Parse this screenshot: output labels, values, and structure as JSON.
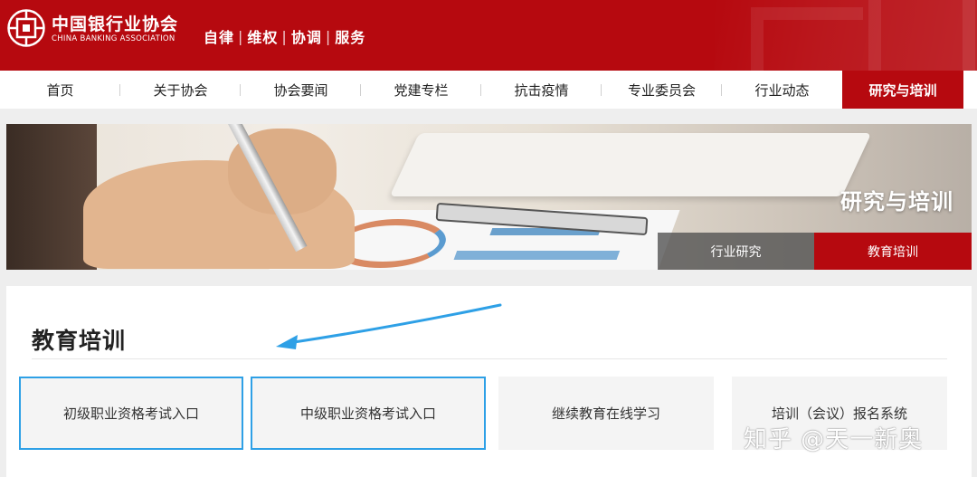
{
  "header": {
    "logo_cn": "中国银行业协会",
    "logo_en": "CHINA BANKING ASSOCIATION",
    "slogan": [
      "自律",
      "维权",
      "协调",
      "服务"
    ],
    "brand_color": "#b6090f"
  },
  "nav": {
    "items": [
      {
        "label": "首页"
      },
      {
        "label": "关于协会"
      },
      {
        "label": "协会要闻"
      },
      {
        "label": "党建专栏"
      },
      {
        "label": "抗击疫情"
      },
      {
        "label": "专业委员会"
      },
      {
        "label": "行业动态"
      },
      {
        "label": "研究与培训"
      }
    ],
    "active": "研究与培训"
  },
  "banner": {
    "title": "研究与培训",
    "subtabs": [
      {
        "label": "行业研究"
      },
      {
        "label": "教育培训"
      }
    ],
    "active_subtab": "教育培训"
  },
  "section": {
    "title": "教育培训",
    "cards": [
      {
        "label": "初级职业资格考试入口"
      },
      {
        "label": "中级职业资格考试入口"
      },
      {
        "label": "继续教育在线学习"
      },
      {
        "label": "培训（会议）报名系统"
      }
    ],
    "highlight_color": "#2ea0e6"
  },
  "watermark": "知乎 @天一新奥"
}
